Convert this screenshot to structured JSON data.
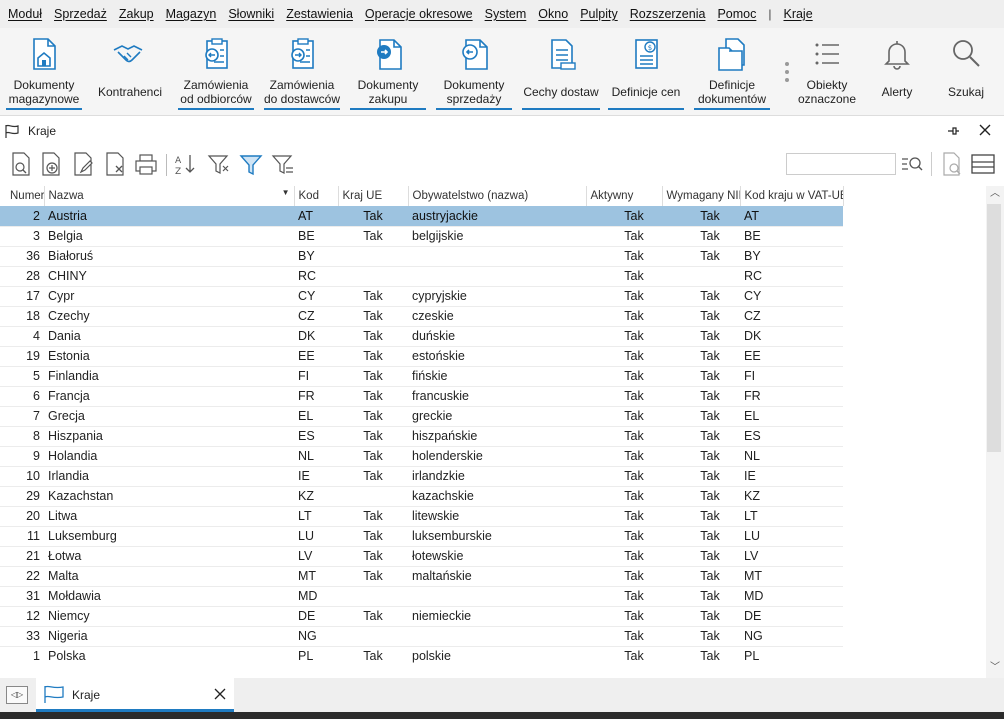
{
  "menu": [
    "Moduł",
    "Sprzedaż",
    "Zakup",
    "Magazyn",
    "Słowniki",
    "Zestawienia",
    "Operacje okresowe",
    "System",
    "Okno",
    "Pulpity",
    "Rozszerzenia",
    "Pomoc",
    "|",
    "Kraje"
  ],
  "ribbon": {
    "dokumenty_magazynowe": "Dokumenty\nmagazynowe",
    "kontrahenci": "Kontrahenci",
    "zamowienia_odbiorcow": "Zamówienia\nod odbiorców",
    "zamowienia_dostawcow": "Zamówienia\ndo dostawców",
    "dokumenty_zakupu": "Dokumenty\nzakupu",
    "dokumenty_sprzedazy": "Dokumenty\nsprzedaży",
    "cechy_dostaw": "Cechy dostaw",
    "definicje_cen": "Definicje cen",
    "definicje_dokumentow": "Definicje\ndokumentów",
    "obiekty_oznaczone": "Obiekty\noznaczone",
    "alerty": "Alerty",
    "szukaj": "Szukaj"
  },
  "window": {
    "title": "Kraje"
  },
  "search": {
    "value": ""
  },
  "columns": [
    "Numer",
    "Nazwa",
    "Kod",
    "Kraj UE",
    "Obywatelstwo (nazwa)",
    "Aktywny",
    "Wymagany NIP",
    "Kod kraju w VAT-UE"
  ],
  "rows": [
    [
      "2",
      "Austria",
      "AT",
      "Tak",
      "austryjackie",
      "Tak",
      "Tak",
      "AT"
    ],
    [
      "3",
      "Belgia",
      "BE",
      "Tak",
      "belgijskie",
      "Tak",
      "Tak",
      "BE"
    ],
    [
      "36",
      "Białoruś",
      "BY",
      "",
      "",
      "Tak",
      "Tak",
      "BY"
    ],
    [
      "28",
      "CHINY",
      "RC",
      "",
      "",
      "Tak",
      "",
      "RC"
    ],
    [
      "17",
      "Cypr",
      "CY",
      "Tak",
      "cypryjskie",
      "Tak",
      "Tak",
      "CY"
    ],
    [
      "18",
      "Czechy",
      "CZ",
      "Tak",
      "czeskie",
      "Tak",
      "Tak",
      "CZ"
    ],
    [
      "4",
      "Dania",
      "DK",
      "Tak",
      "duńskie",
      "Tak",
      "Tak",
      "DK"
    ],
    [
      "19",
      "Estonia",
      "EE",
      "Tak",
      "estońskie",
      "Tak",
      "Tak",
      "EE"
    ],
    [
      "5",
      "Finlandia",
      "FI",
      "Tak",
      "fińskie",
      "Tak",
      "Tak",
      "FI"
    ],
    [
      "6",
      "Francja",
      "FR",
      "Tak",
      "francuskie",
      "Tak",
      "Tak",
      "FR"
    ],
    [
      "7",
      "Grecja",
      "EL",
      "Tak",
      "greckie",
      "Tak",
      "Tak",
      "EL"
    ],
    [
      "8",
      "Hiszpania",
      "ES",
      "Tak",
      "hiszpańskie",
      "Tak",
      "Tak",
      "ES"
    ],
    [
      "9",
      "Holandia",
      "NL",
      "Tak",
      "holenderskie",
      "Tak",
      "Tak",
      "NL"
    ],
    [
      "10",
      "Irlandia",
      "IE",
      "Tak",
      "irlandzkie",
      "Tak",
      "Tak",
      "IE"
    ],
    [
      "29",
      "Kazachstan",
      "KZ",
      "",
      "kazachskie",
      "Tak",
      "Tak",
      "KZ"
    ],
    [
      "20",
      "Litwa",
      "LT",
      "Tak",
      "litewskie",
      "Tak",
      "Tak",
      "LT"
    ],
    [
      "11",
      "Luksemburg",
      "LU",
      "Tak",
      "luksemburskie",
      "Tak",
      "Tak",
      "LU"
    ],
    [
      "21",
      "Łotwa",
      "LV",
      "Tak",
      "łotewskie",
      "Tak",
      "Tak",
      "LV"
    ],
    [
      "22",
      "Malta",
      "MT",
      "Tak",
      "maltańskie",
      "Tak",
      "Tak",
      "MT"
    ],
    [
      "31",
      "Mołdawia",
      "MD",
      "",
      "",
      "Tak",
      "Tak",
      "MD"
    ],
    [
      "12",
      "Niemcy",
      "DE",
      "Tak",
      "niemieckie",
      "Tak",
      "Tak",
      "DE"
    ],
    [
      "33",
      "Nigeria",
      "NG",
      "",
      "",
      "Tak",
      "Tak",
      "NG"
    ],
    [
      "1",
      "Polska",
      "PL",
      "Tak",
      "polskie",
      "Tak",
      "Tak",
      "PL"
    ]
  ],
  "selected_row": 0,
  "bottom_tab": {
    "label": "Kraje"
  },
  "colors": {
    "accent": "#1f7bc1",
    "selected": "#9dc3e0"
  }
}
